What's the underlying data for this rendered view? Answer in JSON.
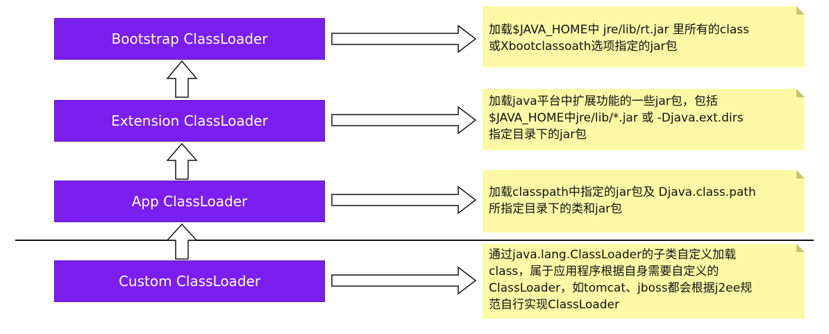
{
  "loaders": [
    {
      "id": "bootstrap",
      "label": "Bootstrap ClassLoader"
    },
    {
      "id": "extension",
      "label": "Extension ClassLoader"
    },
    {
      "id": "app",
      "label": "App ClassLoader"
    },
    {
      "id": "custom",
      "label": "Custom ClassLoader"
    }
  ],
  "notes": [
    {
      "lines": [
        "加载$JAVA_HOME中 jre/lib/rt.jar 里所有的class",
        "或Xbootclassoath选项指定的jar包"
      ]
    },
    {
      "lines": [
        "加载java平台中扩展功能的一些jar包，包括",
        "$JAVA_HOME中jre/lib/*.jar 或 -Djava.ext.dirs",
        "指定目录下的jar包"
      ]
    },
    {
      "lines": [
        "加载classpath中指定的jar包及 Djava.class.path",
        "所指定目录下的类和jar包"
      ]
    },
    {
      "lines": [
        "通过java.lang.ClassLoader的子类自定义加载",
        "class，属于应用程序根据自身需要自定义的",
        "ClassLoader，如tomcat、jboss都会根据j2ee规",
        "范自行实现ClassLoader"
      ]
    }
  ],
  "colors": {
    "loader_fill": "#7a1ff0",
    "note_fill": "#fbf9a6",
    "arrow_stroke": "#111111",
    "divider": "#111111"
  }
}
